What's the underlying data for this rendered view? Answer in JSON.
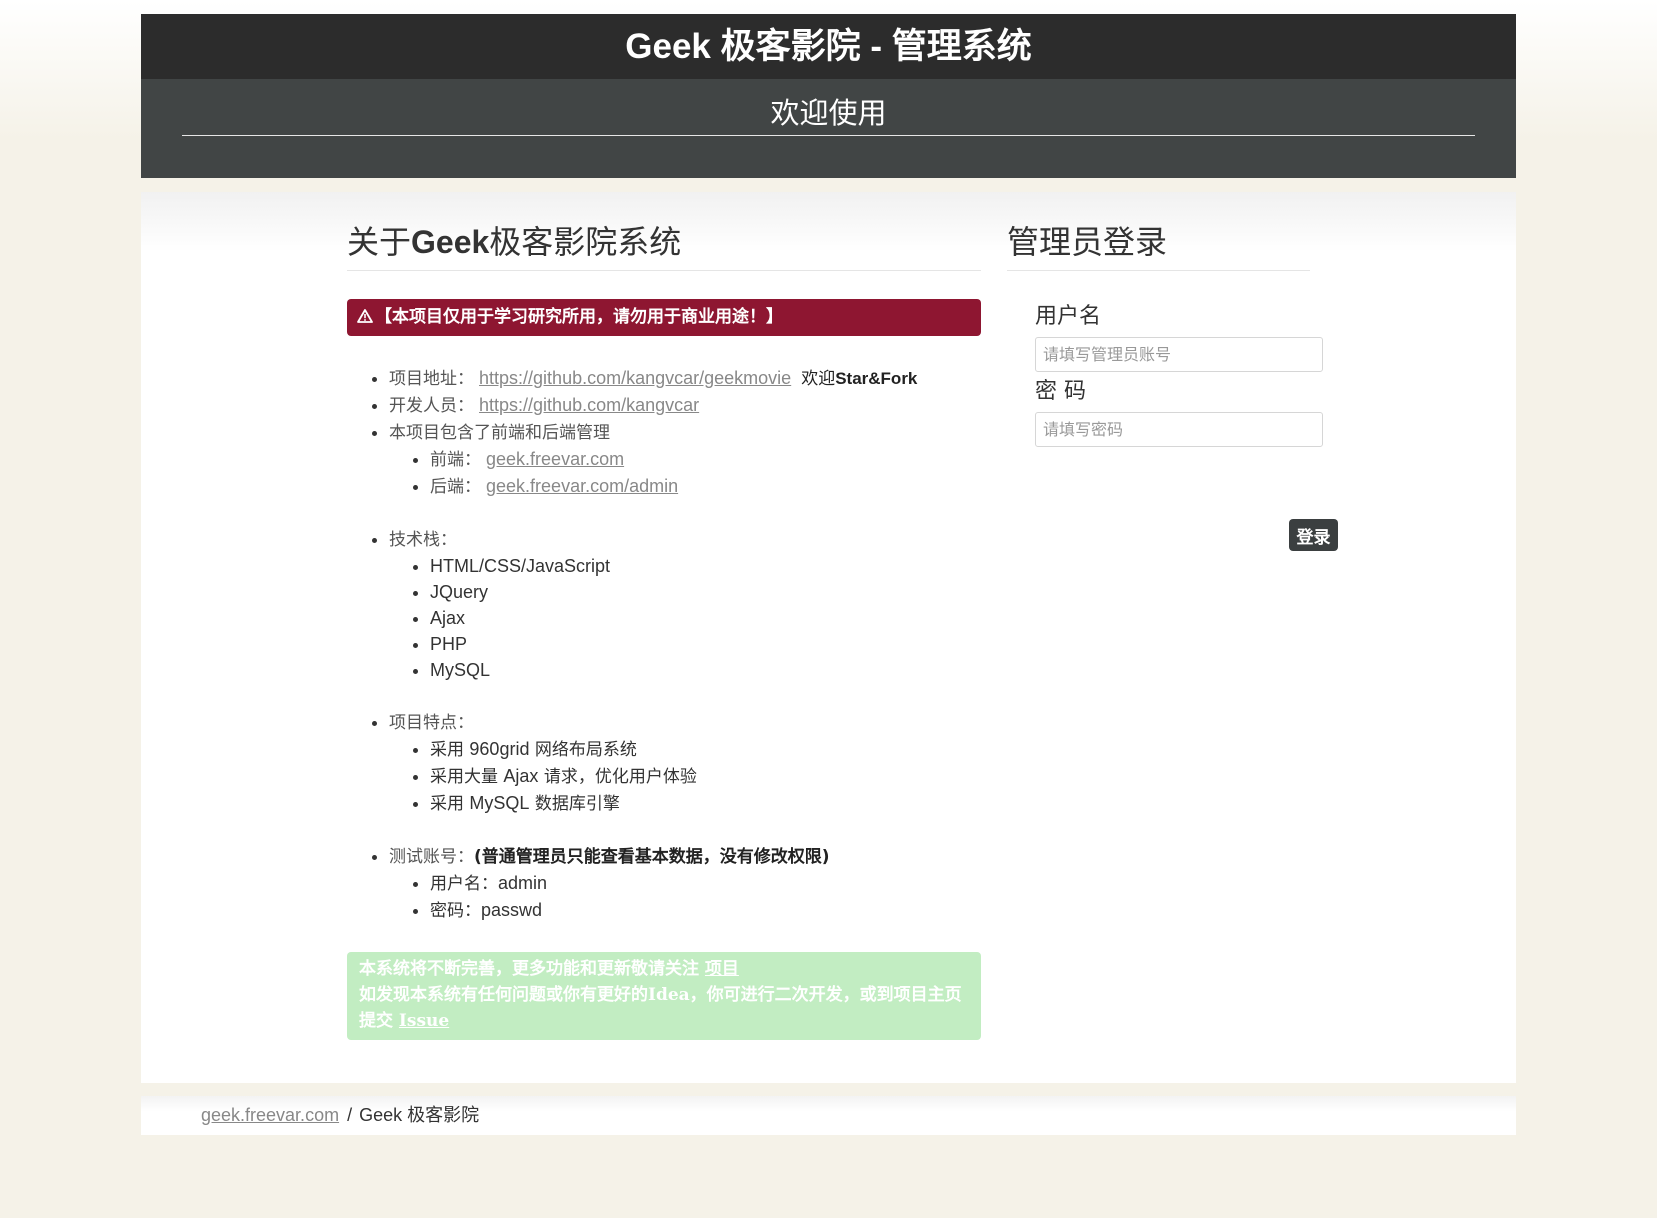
{
  "header": {
    "title": "Geek 极客影院 - 管理系统",
    "welcome": "欢迎使用"
  },
  "about": {
    "title_prefix": "关于",
    "title_bold": "Geek",
    "title_suffix": "极客影院系统",
    "warning": "【本项目仅用于学习研究所用，请勿用于商业用途！】",
    "project_label": "项目地址：",
    "project_url": "https://github.com/kangvcar/geekmovie",
    "project_welcome_cn": "欢迎",
    "project_welcome_en": "Star&Fork",
    "dev_label": "开发人员：",
    "dev_url": "https://github.com/kangvcar",
    "includes": "本项目包含了前端和后端管理",
    "frontend_label": "前端：",
    "frontend_url": "geek.freevar.com",
    "backend_label": "后端：",
    "backend_url": "geek.freevar.com/admin",
    "stack_label": "技术栈：",
    "stack": [
      "HTML/CSS/JavaScript",
      "JQuery",
      "Ajax",
      "PHP",
      "MySQL"
    ],
    "features_label": "项目特点：",
    "features": [
      {
        "pre": "采用 ",
        "en": "960grid",
        "post": " 网络布局系统"
      },
      {
        "pre": "采用大量 ",
        "en": "Ajax",
        "post": " 请求，优化用户体验"
      },
      {
        "pre": "采用 ",
        "en": "MySQL",
        "post": " 数据库引擎"
      }
    ],
    "test_label": "测试账号：",
    "test_note": "(普通管理员只能查看基本数据，没有修改权限)",
    "test_user_label": "用户名：",
    "test_user": "admin",
    "test_pass_label": "密码：",
    "test_pass": "passwd",
    "note_line1": "本系统将不断完善，更多功能和更新敬请关注 ",
    "note_line1_link": "项目",
    "note_line2": "如发现本系统有任何问题或你有更好的Idea，你可进行二次开发，或到项目主页提交 ",
    "note_line2_link": "Issue"
  },
  "login": {
    "title": "管理员登录",
    "username_label": "用户名",
    "username_placeholder": "请填写管理员账号",
    "password_label": "密 码",
    "password_placeholder": "请填写密码",
    "submit": "登录"
  },
  "footer": {
    "site": "geek.freevar.com",
    "separator": "/",
    "name": "Geek 极客影院"
  },
  "colors": {
    "header_dark": "#2c2c2c",
    "header_sub": "#414545",
    "warning_bg": "#8e1631",
    "note_bg": "#c2edc2",
    "button_bg": "#3b3f40",
    "page_bg": "#f5f2e8"
  }
}
